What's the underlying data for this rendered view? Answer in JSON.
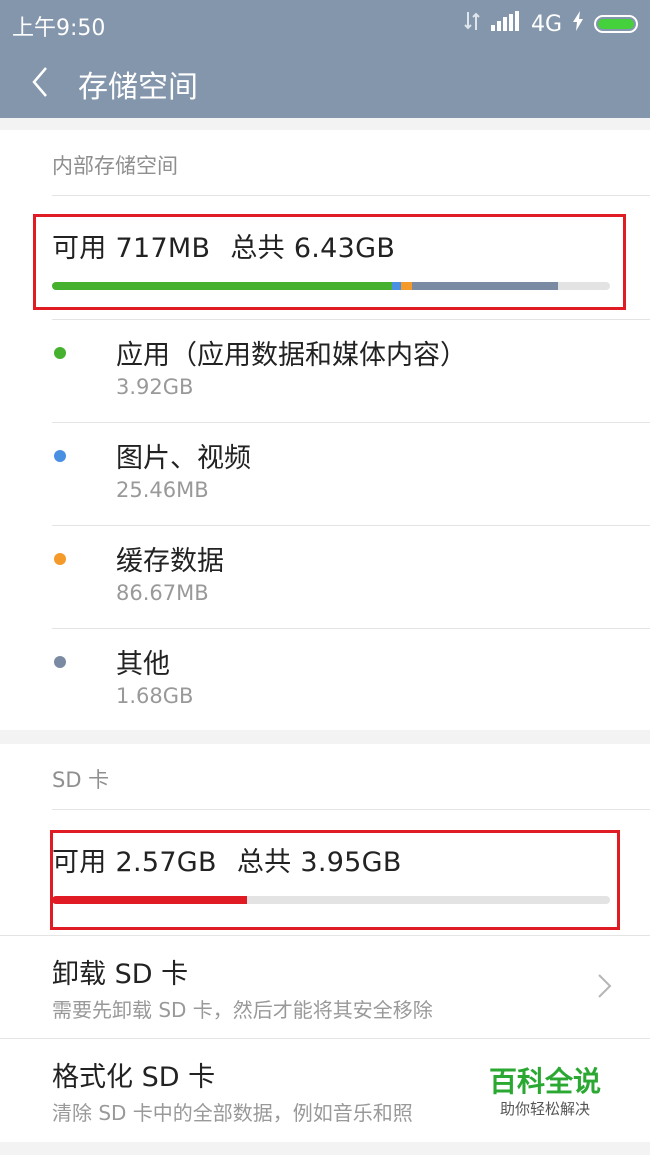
{
  "status_bar": {
    "time": "上午9:50",
    "network": "4G"
  },
  "header": {
    "title": "存储空间"
  },
  "internal": {
    "section_label": "内部存储空间",
    "available_label": "可用 717MB",
    "total_label": "总共 6.43GB",
    "usage_bar": [
      {
        "name": "应用",
        "fraction": 0.61,
        "color": "#46b12f"
      },
      {
        "name": "图片、视频",
        "fraction": 0.015,
        "color": "#4a90e2"
      },
      {
        "name": "缓存数据",
        "fraction": 0.02,
        "color": "#f39a2a"
      },
      {
        "name": "其他",
        "fraction": 0.262,
        "color": "#7b8aa3"
      }
    ],
    "legend": [
      {
        "name": "应用（应用数据和媒体内容）",
        "size": "3.92GB",
        "color": "#46b12f"
      },
      {
        "name": "图片、视频",
        "size": "25.46MB",
        "color": "#4a90e2"
      },
      {
        "name": "缓存数据",
        "size": "86.67MB",
        "color": "#f39a2a"
      },
      {
        "name": "其他",
        "size": "1.68GB",
        "color": "#7b8aa3"
      }
    ]
  },
  "sd": {
    "section_label": "SD 卡",
    "available_label": "可用 2.57GB",
    "total_label": "总共 3.95GB",
    "used_fraction": 0.35,
    "used_color": "#e01b24",
    "unmount": {
      "title": "卸载 SD 卡",
      "desc": "需要先卸载 SD 卡，然后才能将其安全移除"
    },
    "format": {
      "title": "格式化 SD 卡",
      "desc": "清除 SD 卡中的全部数据，例如音乐和照"
    }
  },
  "watermark": {
    "title": "百科全说",
    "subtitle": "助你轻松解决"
  }
}
